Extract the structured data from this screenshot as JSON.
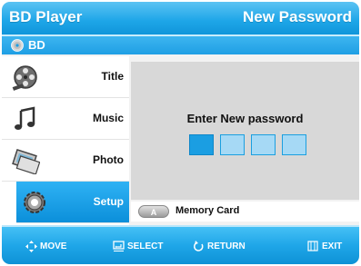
{
  "header": {
    "app_title": "BD Player",
    "page_title": "New Password"
  },
  "source": {
    "label": "BD",
    "icon": "disc-icon"
  },
  "menu": {
    "items": [
      {
        "label": "Title",
        "icon": "film-reel-icon"
      },
      {
        "label": "Music",
        "icon": "music-note-icon"
      },
      {
        "label": "Photo",
        "icon": "photo-icon"
      },
      {
        "label": "Setup",
        "icon": "gear-icon",
        "selected": true
      }
    ]
  },
  "password": {
    "prompt": "Enter New password",
    "digits": 4,
    "active_index": 0
  },
  "hint": {
    "button_label": "A",
    "label": "Memory Card"
  },
  "footer": {
    "move": "MOVE",
    "select": "SELECT",
    "return": "RETURN",
    "exit": "EXIT"
  },
  "colors": {
    "accent": "#1ea6e8",
    "panel": "#d8d8d8",
    "box_fill": "#a6d9f5",
    "box_active": "#1b9ee2"
  }
}
